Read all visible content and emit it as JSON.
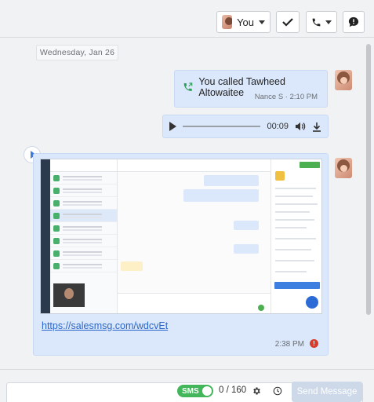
{
  "toolbar": {
    "assignee_label": "You",
    "icons": [
      "avatar-you",
      "chevron-down-icon",
      "check-icon",
      "phone-icon",
      "chevron-down-icon",
      "note-icon"
    ]
  },
  "thread": {
    "date_divider": "Wednesday, Jan 26",
    "call_message": {
      "text": "You called Tawheed Altowaitee",
      "meta": "Nance S · 2:10 PM",
      "icon": "phone-outgoing-icon"
    },
    "audio": {
      "time": "00:09",
      "progress": 0
    },
    "media_message": {
      "link": "https://salesmsg.com/wdcvEt",
      "time": "2:38 PM",
      "status_icon": "error-icon",
      "error_glyph": "!"
    }
  },
  "composer": {
    "channel_label": "SMS",
    "char_count": "0 / 160",
    "send_label": "Send Message"
  },
  "colors": {
    "bubble": "#dbe8fb",
    "accent_green": "#43b55b",
    "link": "#2a66c9",
    "error": "#d93b2b"
  }
}
